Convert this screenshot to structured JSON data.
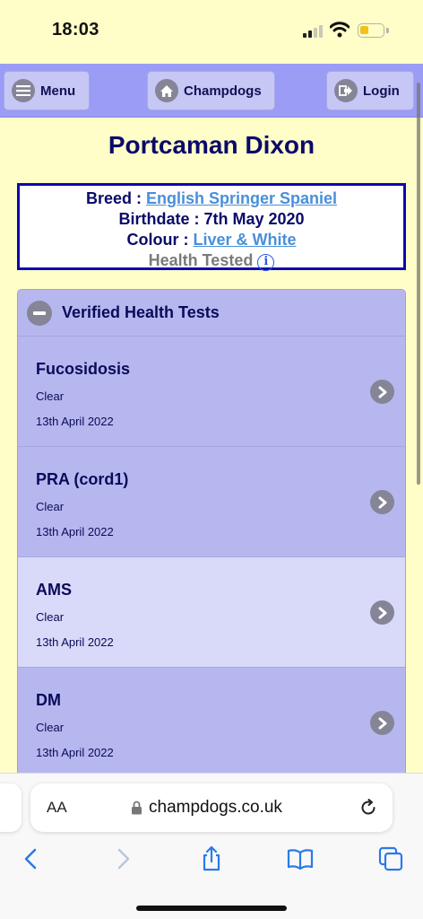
{
  "status_bar": {
    "time": "18:03"
  },
  "nav": {
    "menu_label": "Menu",
    "home_label": "Champdogs",
    "login_label": "Login"
  },
  "dog": {
    "name": "Portcaman Dixon",
    "breed_label": "Breed :",
    "breed": "English Springer Spaniel",
    "birthdate_label": "Birthdate :",
    "birthdate": "7th May 2020",
    "colour_label": "Colour :",
    "colour": "Liver & White",
    "health_tested": "Health Tested"
  },
  "health": {
    "title": "Verified Health Tests",
    "tests": [
      {
        "name": "Fucosidosis",
        "result": "Clear",
        "date": "13th April 2022"
      },
      {
        "name": "PRA (cord1)",
        "result": "Clear",
        "date": "13th April 2022"
      },
      {
        "name": "AMS",
        "result": "Clear",
        "date": "13th April 2022"
      },
      {
        "name": "DM",
        "result": "Clear",
        "date": "13th April 2022"
      }
    ]
  },
  "browser": {
    "aa_label": "AA",
    "url": "champdogs.co.uk"
  },
  "colors": {
    "background": "#fffdc8",
    "navbar": "#9b9cf5",
    "panel": "#b7b7ef",
    "highlight_row": "#d9d9f9",
    "title": "#0a0a6a",
    "link": "#4a8fd8"
  }
}
